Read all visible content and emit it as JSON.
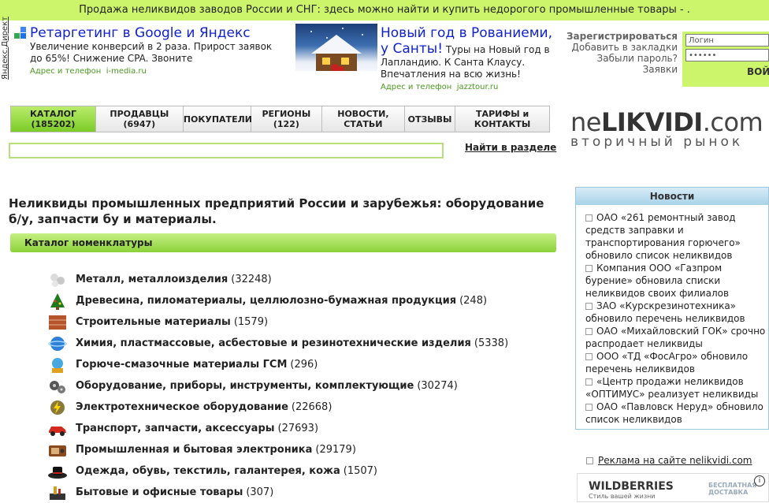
{
  "top_banner": "Продажа неликвидов заводов России и СНГ: здесь можно найти и купить недорогого промышленные товары - .",
  "yandex_direct": "Яндекс.Директ",
  "ad1": {
    "title": "Ретаргетинг в Google и Яндекс",
    "body": "Увеличение конверсий в 2 раза. Прирост заявок до 65%! Снижение CPA. Звоните",
    "meta_label": "Адрес и телефон",
    "domain": "i-media.ru"
  },
  "ad2": {
    "title": "Новый год в Рованиеми, у Санты!",
    "body": "Туры на Новый год в Лапландию. К Санта Клаусу. Впечатления на всю жизнь!",
    "meta_label": "Адрес и телефон",
    "domain": "jazztour.ru"
  },
  "login": {
    "register": "Зарегистрироваться",
    "bookmark": "Добавить в закладки",
    "forgot": "Забыли пароль?",
    "orders": "Заявки",
    "login_placeholder": "Логин",
    "password_mask": "••••••",
    "submit": "ВОЙ"
  },
  "nav": [
    {
      "label": "КАТАЛОГ",
      "sub": "(185202)",
      "active": true
    },
    {
      "label": "ПРОДАВЦЫ",
      "sub": "(6947)",
      "active": false
    },
    {
      "label": "ПОКУПАТЕЛИ",
      "sub": "",
      "active": false
    },
    {
      "label": "РЕГИОНЫ",
      "sub": "(122)",
      "active": false
    },
    {
      "label": "НОВОСТИ,",
      "sub": "СТАТЬИ",
      "active": false
    },
    {
      "label": "ОТЗЫВЫ",
      "sub": "",
      "active": false
    },
    {
      "label": "ТАРИФЫ и",
      "sub": "КОНТАКТЫ",
      "active": false
    }
  ],
  "logo": {
    "part1": "ne",
    "part2": "LIKVIDI",
    "part3": ".com",
    "tagline": "вторичный рынок"
  },
  "search": {
    "button": "Найти в разделе"
  },
  "heading": "Неликвиды промышленных предприятий России и зарубежья: оборудование б/у, запчасти бу и материалы.",
  "catalog_bar": "Каталог номенклатуры",
  "categories": [
    {
      "name": "Металл, металлоизделия",
      "count": "(32248)",
      "icon": "metal-icon"
    },
    {
      "name": "Древесина, пиломатериалы, целлюлозно-бумажная продукция",
      "count": "(248)",
      "icon": "tree-icon"
    },
    {
      "name": "Строительные материалы",
      "count": "(1579)",
      "icon": "brick-icon"
    },
    {
      "name": "Химия, пластмассовые, асбестовые и резинотехнические изделия",
      "count": "(5338)",
      "icon": "chemistry-icon"
    },
    {
      "name": "Горюче-смазочные материалы ГСМ",
      "count": "(296)",
      "icon": "fuel-icon"
    },
    {
      "name": "Оборудование, приборы, инструменты, комплектующие",
      "count": "(30274)",
      "icon": "gears-icon"
    },
    {
      "name": "Электротехническое оборудование",
      "count": "(22668)",
      "icon": "electric-icon"
    },
    {
      "name": "Транспорт, запчасти, аксессуары",
      "count": "(27693)",
      "icon": "car-icon"
    },
    {
      "name": "Промышленная и бытовая электроника",
      "count": "(29179)",
      "icon": "radio-icon"
    },
    {
      "name": "Одежда, обувь, текстиль, галантерея, кожа",
      "count": "(1507)",
      "icon": "hat-icon"
    },
    {
      "name": "Бытовые и офисные товары",
      "count": "(307)",
      "icon": "office-icon"
    }
  ],
  "news": {
    "title": "Новости",
    "items": [
      "ОАО «261 ремонтный завод средств заправки и транспортирования горючего» обновило список неликвидов",
      "Компания ООО «Газпром бурение» обновила списки неликвидов своих филиалов",
      "ЗАО «Курскрезинотехника» обновило перечень неликвидов",
      "ОАО «Михайловский ГОК» срочно распродает неликвиды",
      "ООО «ТД «ФосАгро» обновило перечень неликвидов",
      "«Центр продажи неликвидов «ОПТИМУС» реализует неликвиды",
      "ОАО «Павловск Неруд» обновило список неликвидов"
    ]
  },
  "advert_link": "Реклама на сайте nelikvidi.com",
  "wildberries": {
    "name": "WILDBERRIES",
    "slogan": "Стиль вашей жизни",
    "delivery": "БЕСПЛАТНАЯ ДОСТАВКА"
  },
  "colors": {
    "green": "#cdf56c",
    "nav_active": "#8cd13a",
    "ad_link": "#1122cc",
    "news_border": "#9cc7dd"
  }
}
